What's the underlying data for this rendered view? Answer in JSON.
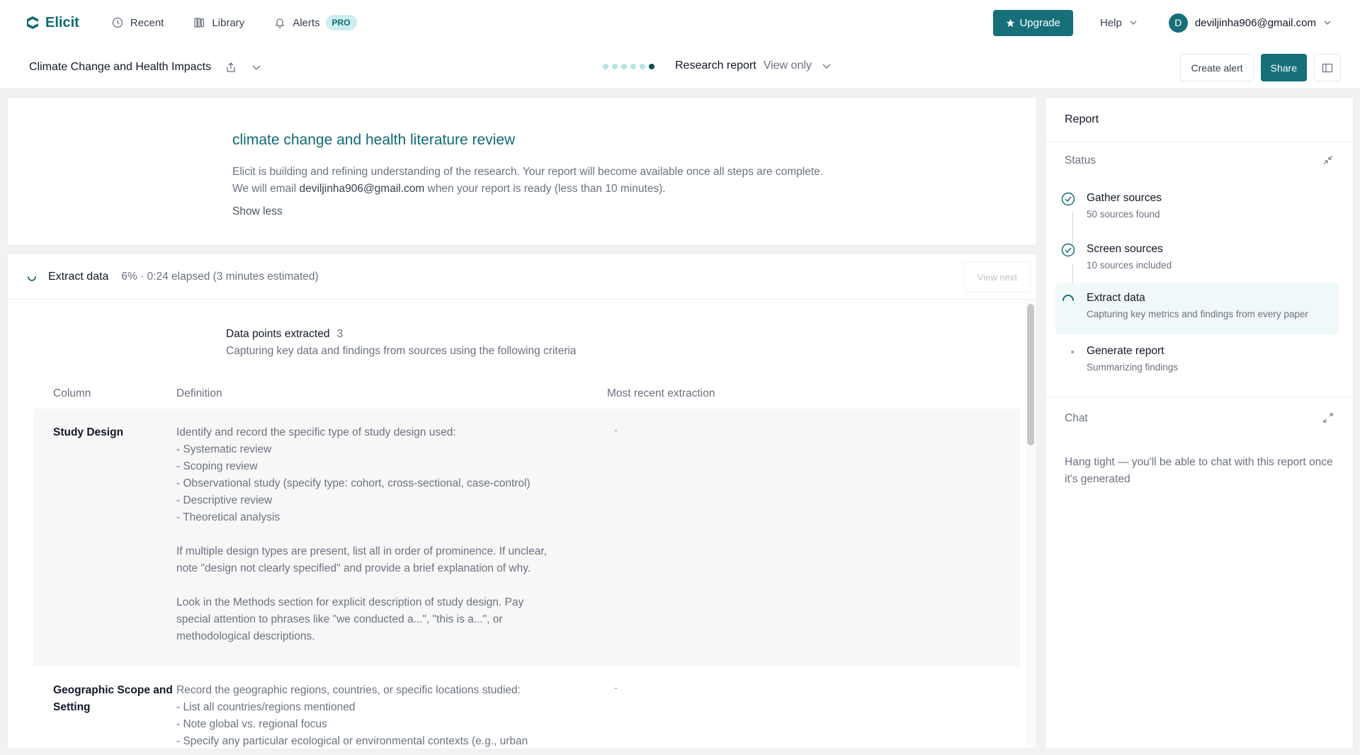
{
  "nav": {
    "logo": "Elicit",
    "recent": "Recent",
    "library": "Library",
    "alerts": "Alerts",
    "pro_badge": "PRO",
    "upgrade": "Upgrade",
    "help": "Help",
    "user_initial": "D",
    "user_email": "deviljinha906@gmail.com"
  },
  "subbar": {
    "project_title": "Climate Change and Health Impacts",
    "report_type": "Research report",
    "access": "View only",
    "create_alert": "Create alert",
    "share": "Share",
    "progress_total_dots": 6,
    "progress_active_dot": 6
  },
  "intro": {
    "title": "climate change and health literature review",
    "text_before_email": "Elicit is building and refining understanding of the research. Your report will become available once all steps are complete. We will email ",
    "email": "deviljinha906@gmail.com",
    "text_after_email": " when your report is ready (less than 10 minutes).",
    "show_less": "Show less"
  },
  "extract": {
    "label": "Extract data",
    "meta": "6% · 0:24 elapsed (3 minutes estimated)",
    "view_next": "View next",
    "data_points_label": "Data points extracted",
    "data_points_count": "3",
    "data_points_sub": "Capturing key data and findings from sources using the following criteria",
    "columns": [
      "Column",
      "Definition",
      "Most recent extraction"
    ],
    "rows": [
      {
        "name": "Study Design",
        "definition": [
          "Identify and record the specific type of study design used:",
          "- Systematic review",
          "- Scoping review",
          "- Observational study (specify type: cohort, cross-sectional, case-control)",
          "- Descriptive review",
          "- Theoretical analysis",
          "",
          "If multiple design types are present, list all in order of prominence. If unclear,",
          "note \"design not clearly specified\" and provide a brief explanation of why.",
          "",
          "Look in the Methods section for explicit description of study design. Pay",
          "special attention to phrases like \"we conducted a...\", \"this is a...\", or",
          "methodological descriptions."
        ],
        "recent": "-"
      },
      {
        "name": "Geographic Scope and Setting",
        "definition": [
          "Record the geographic regions, countries, or specific locations studied:",
          "- List all countries/regions mentioned",
          "- Note global vs. regional focus",
          "- Specify any particular ecological or environmental contexts (e.g., urban"
        ],
        "recent": "-"
      }
    ]
  },
  "sidebar": {
    "title": "Report",
    "status_label": "Status",
    "steps": [
      {
        "title": "Gather sources",
        "sub": "50 sources found",
        "state": "done"
      },
      {
        "title": "Screen sources",
        "sub": "10 sources included",
        "state": "done"
      },
      {
        "title": "Extract data",
        "sub": "Capturing key metrics and findings from every paper",
        "state": "current"
      },
      {
        "title": "Generate report",
        "sub": "Summarizing findings",
        "state": "pending"
      }
    ],
    "chat_label": "Chat",
    "chat_text": "Hang tight — you'll be able to chat with this report once it's generated"
  },
  "colors": {
    "accent": "#176f7a",
    "accent_text": "#0f6a73",
    "pro_bg": "#cdeef0",
    "current_step_bg": "#f0f9f9"
  }
}
